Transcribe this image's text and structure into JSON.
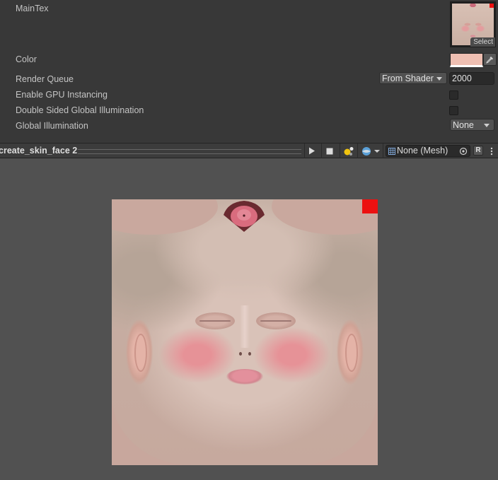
{
  "inspector": {
    "maintex_label": "MainTex",
    "select_label": "Select",
    "color_label": "Color",
    "color_value": "#efbfb2",
    "render_queue_label": "Render Queue",
    "render_queue_mode": "From Shader",
    "render_queue_value": "2000",
    "gpu_instancing_label": "Enable GPU Instancing",
    "double_sided_gi_label": "Double Sided Global Illumination",
    "global_illumination_label": "Global Illumination",
    "global_illumination_value": "None"
  },
  "preview_toolbar": {
    "title": "create_skin_face 2",
    "mesh_value": "None (Mesh)",
    "reset_label": "R",
    "icons": [
      "play-icon",
      "stop-icon",
      "light-icon",
      "sphere-icon",
      "target-icon",
      "more-icon"
    ]
  },
  "preview": {
    "background": "#515151",
    "texture_description_colors": {
      "skin": "#c8a79d",
      "marker": "#ec1111"
    }
  }
}
